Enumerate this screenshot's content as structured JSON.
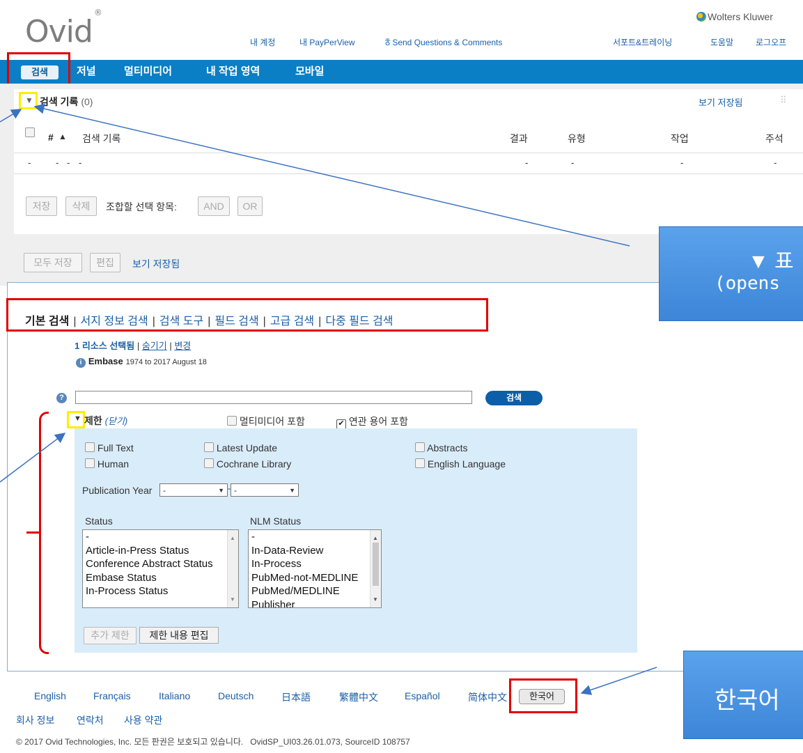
{
  "header": {
    "logo": "Ovid",
    "logo_mark": "®",
    "brand": "Wolters Kluwer",
    "links": [
      "내 계정",
      "내 PayPerView",
      "Send Questions & Comments",
      "서포트&트레이닝",
      "도움말",
      "로그오프"
    ]
  },
  "nav": {
    "items": [
      "검색",
      "저널",
      "멀티미디어",
      "내 작업 영역",
      "모바일"
    ]
  },
  "history": {
    "title": "검색 기록",
    "count": "(0)",
    "view_saved": "보기 저장됨",
    "columns": [
      "#",
      "▲",
      "검색 기록",
      "결과",
      "유형",
      "작업",
      "주석"
    ],
    "empty_row": [
      "-",
      "-",
      "-",
      "-",
      "-",
      "-",
      "-"
    ],
    "save": "저장",
    "delete": "삭제",
    "combine_label": "조합할 선택 항목:",
    "and": "AND",
    "or": "OR",
    "save_all": "모두 저장",
    "edit": "편집",
    "view_saved_bottom": "보기 저장됨"
  },
  "search": {
    "tabs": [
      "기본 검색",
      "서지 정보 검색",
      "검색 도구",
      "필드 검색",
      "고급 검색",
      "다중 필드 검색"
    ],
    "resources_selected": "1 리소스 선택됨",
    "hide": "숨기기",
    "change": "변경",
    "database": "Embase",
    "database_range": "1974 to 2017 August 18",
    "search_button": "검색",
    "query_value": "",
    "limits_label": "제한",
    "limits_close": "(닫기)",
    "include_multimedia": "멀티미디어 포함",
    "include_related": "연관 용어 포함",
    "include_related_checked": true,
    "limits": {
      "checkboxes": [
        "Full Text",
        "Latest Update",
        "Abstracts",
        "Human",
        "Cochrane Library",
        "English Language"
      ],
      "pub_year_label": "Publication Year",
      "pub_year_from": "-",
      "pub_year_to": "-",
      "status_label": "Status",
      "status_options": [
        "-",
        "Article-in-Press Status",
        "Conference Abstract Status",
        "Embase Status",
        "In-Process Status"
      ],
      "nlm_label": "NLM Status",
      "nlm_options": [
        "-",
        "In-Data-Review",
        "In-Process",
        "PubMed-not-MEDLINE",
        "PubMed/MEDLINE",
        "Publisher"
      ],
      "add_limits": "추가 제한",
      "edit_limits": "제한 내용 편집"
    }
  },
  "callouts": {
    "top_line1": "▼ 표",
    "top_line2": "(opens",
    "bottom": "한국어"
  },
  "footer": {
    "languages": [
      "English",
      "Français",
      "Italiano",
      "Deutsch",
      "日本語",
      "繁體中文",
      "Español",
      "简体中文",
      "한국어"
    ],
    "links": [
      "회사 정보",
      "연락처",
      "사용 약관"
    ],
    "copyright": "© 2017 Ovid Technologies, Inc. 모든 판권은 보호되고 있습니다.   OvidSP_UI03.26.01.073, SourceID 108757"
  },
  "colors": {
    "nav": "#0a7fc5",
    "highlight_red": "#e00000",
    "highlight_yellow": "#ffee00",
    "callout": "#4a93e2",
    "limits_bg": "#d9ecfa"
  }
}
